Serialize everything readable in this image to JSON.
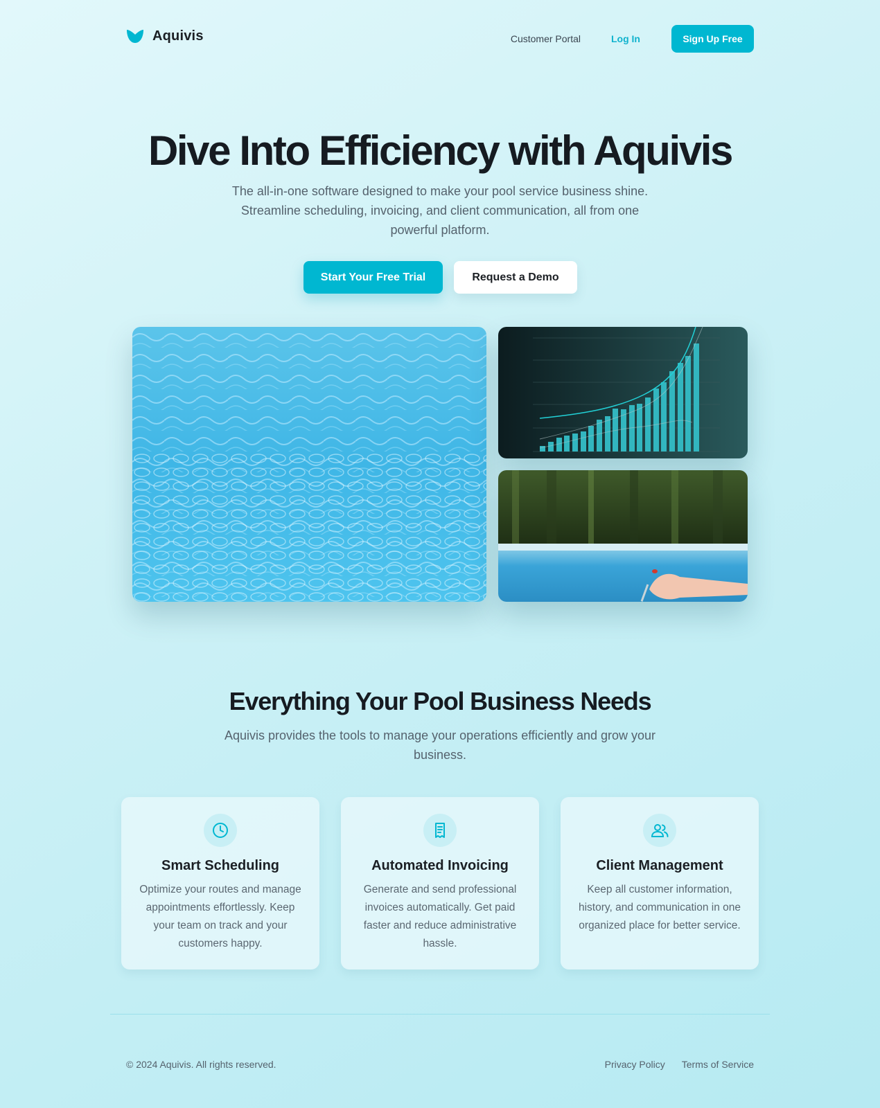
{
  "brand": {
    "name": "Aquivis",
    "accent": "#00b7d1"
  },
  "nav": {
    "customer_portal": "Customer Portal",
    "login": "Log In",
    "signup": "Sign Up Free"
  },
  "hero": {
    "title": "Dive Into Efficiency with Aquivis",
    "subtitle": "The all-in-one software designed to make your pool service business shine. Streamline scheduling, invoicing, and client communication, all from one powerful platform.",
    "primary_cta": "Start Your Free Trial",
    "secondary_cta": "Request a Demo"
  },
  "features": {
    "title": "Everything Your Pool Business Needs",
    "subtitle": "Aquivis provides the tools to manage your operations efficiently and grow your business.",
    "items": [
      {
        "icon": "clock-icon",
        "title": "Smart Scheduling",
        "text": "Optimize your routes and manage appointments effortlessly. Keep your team on track and your customers happy."
      },
      {
        "icon": "receipt-icon",
        "title": "Automated Invoicing",
        "text": "Generate and send professional invoices automatically. Get paid faster and reduce administrative hassle."
      },
      {
        "icon": "users-icon",
        "title": "Client Management",
        "text": "Keep all customer information, history, and communication in one organized place for better service."
      }
    ]
  },
  "footer": {
    "copyright": "© 2024 Aquivis. All rights reserved.",
    "privacy": "Privacy Policy",
    "terms": "Terms of Service"
  }
}
